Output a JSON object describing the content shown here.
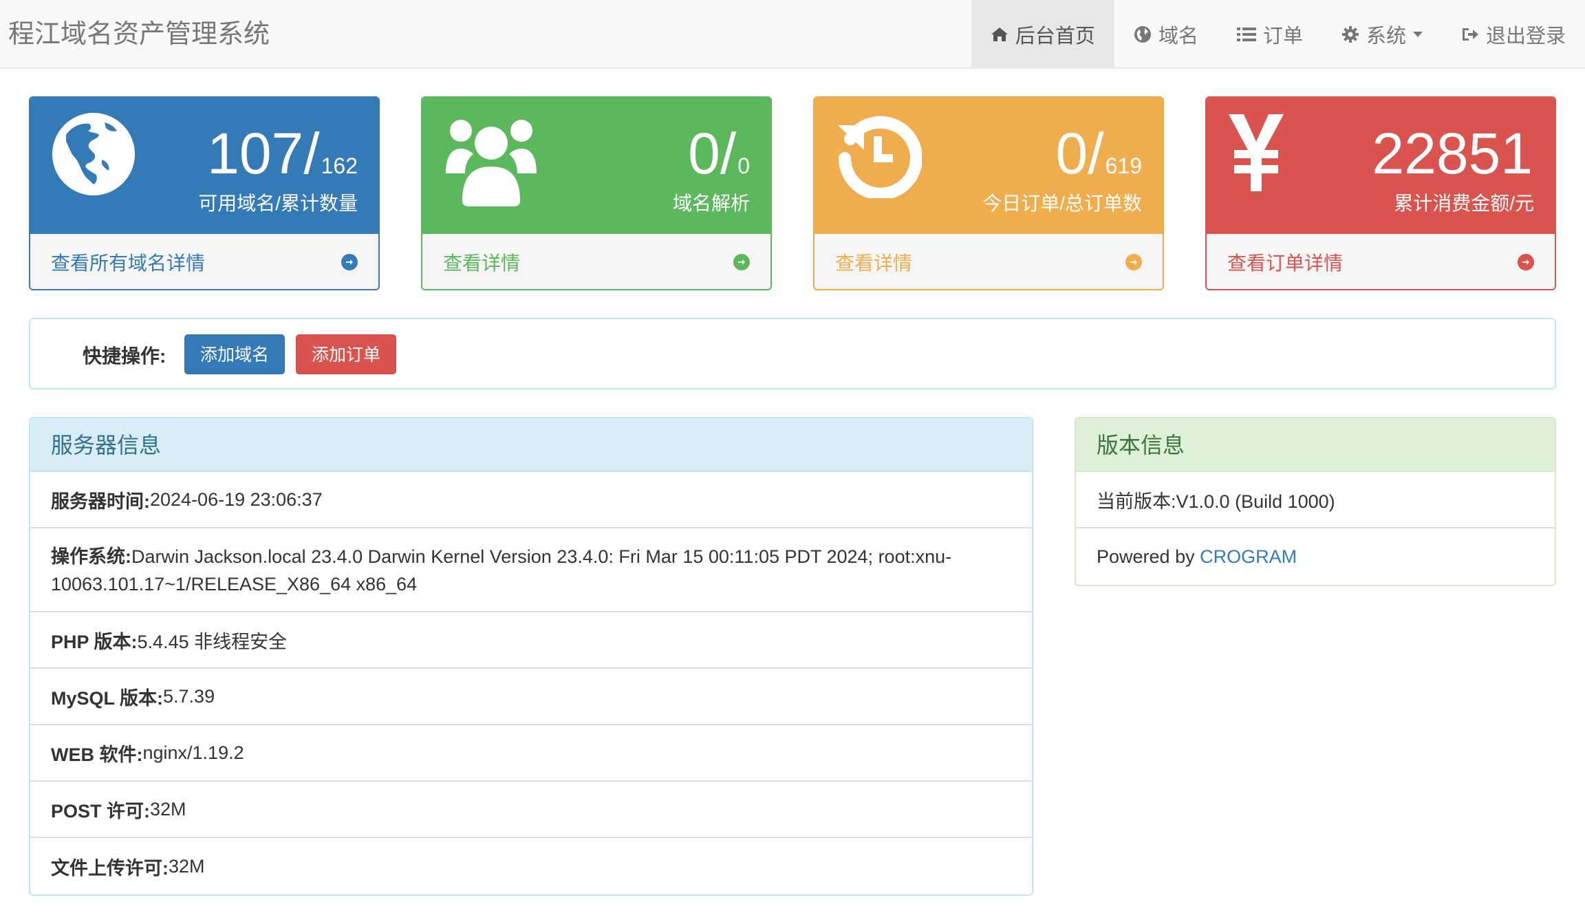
{
  "brand": "程江域名资产管理系统",
  "nav": {
    "home": "后台首页",
    "domains": "域名",
    "orders": "订单",
    "system": "系统",
    "logout": "退出登录"
  },
  "stats": [
    {
      "value": "107/",
      "sub": "162",
      "caption": "可用域名/累计数量",
      "link": "查看所有域名详情",
      "icon": "globe-icon"
    },
    {
      "value": "0/",
      "sub": "0",
      "caption": "域名解析",
      "link": "查看详情",
      "icon": "users-icon"
    },
    {
      "value": "0/",
      "sub": "619",
      "caption": "今日订单/总订单数",
      "link": "查看详情",
      "icon": "history-icon"
    },
    {
      "value": "22851",
      "sub": "",
      "caption": "累计消费金额/元",
      "link": "查看订单详情",
      "icon": "yen-icon"
    }
  ],
  "quick": {
    "label": "快捷操作:",
    "add_domain": "添加域名",
    "add_order": "添加订单"
  },
  "server": {
    "title": "服务器信息",
    "rows": [
      {
        "key": "服务器时间:",
        "value": "2024-06-19 23:06:37"
      },
      {
        "key": "操作系统:",
        "value": "Darwin Jackson.local 23.4.0 Darwin Kernel Version 23.4.0: Fri Mar 15 00:11:05 PDT 2024; root:xnu-10063.101.17~1/RELEASE_X86_64 x86_64"
      },
      {
        "key": "PHP 版本:",
        "value": "5.4.45 非线程安全"
      },
      {
        "key": "MySQL 版本:",
        "value": "5.7.39"
      },
      {
        "key": "WEB 软件:",
        "value": "nginx/1.19.2"
      },
      {
        "key": "POST 许可:",
        "value": "32M"
      },
      {
        "key": "文件上传许可:",
        "value": "32M"
      }
    ]
  },
  "version": {
    "title": "版本信息",
    "current": "当前版本:V1.0.0 (Build 1000)",
    "powered_prefix": "Powered by ",
    "powered_link": "CROGRAM"
  },
  "colors": {
    "primary": "#337ab7",
    "success": "#5cb85c",
    "warning": "#f0ad4e",
    "danger": "#d9534f"
  }
}
